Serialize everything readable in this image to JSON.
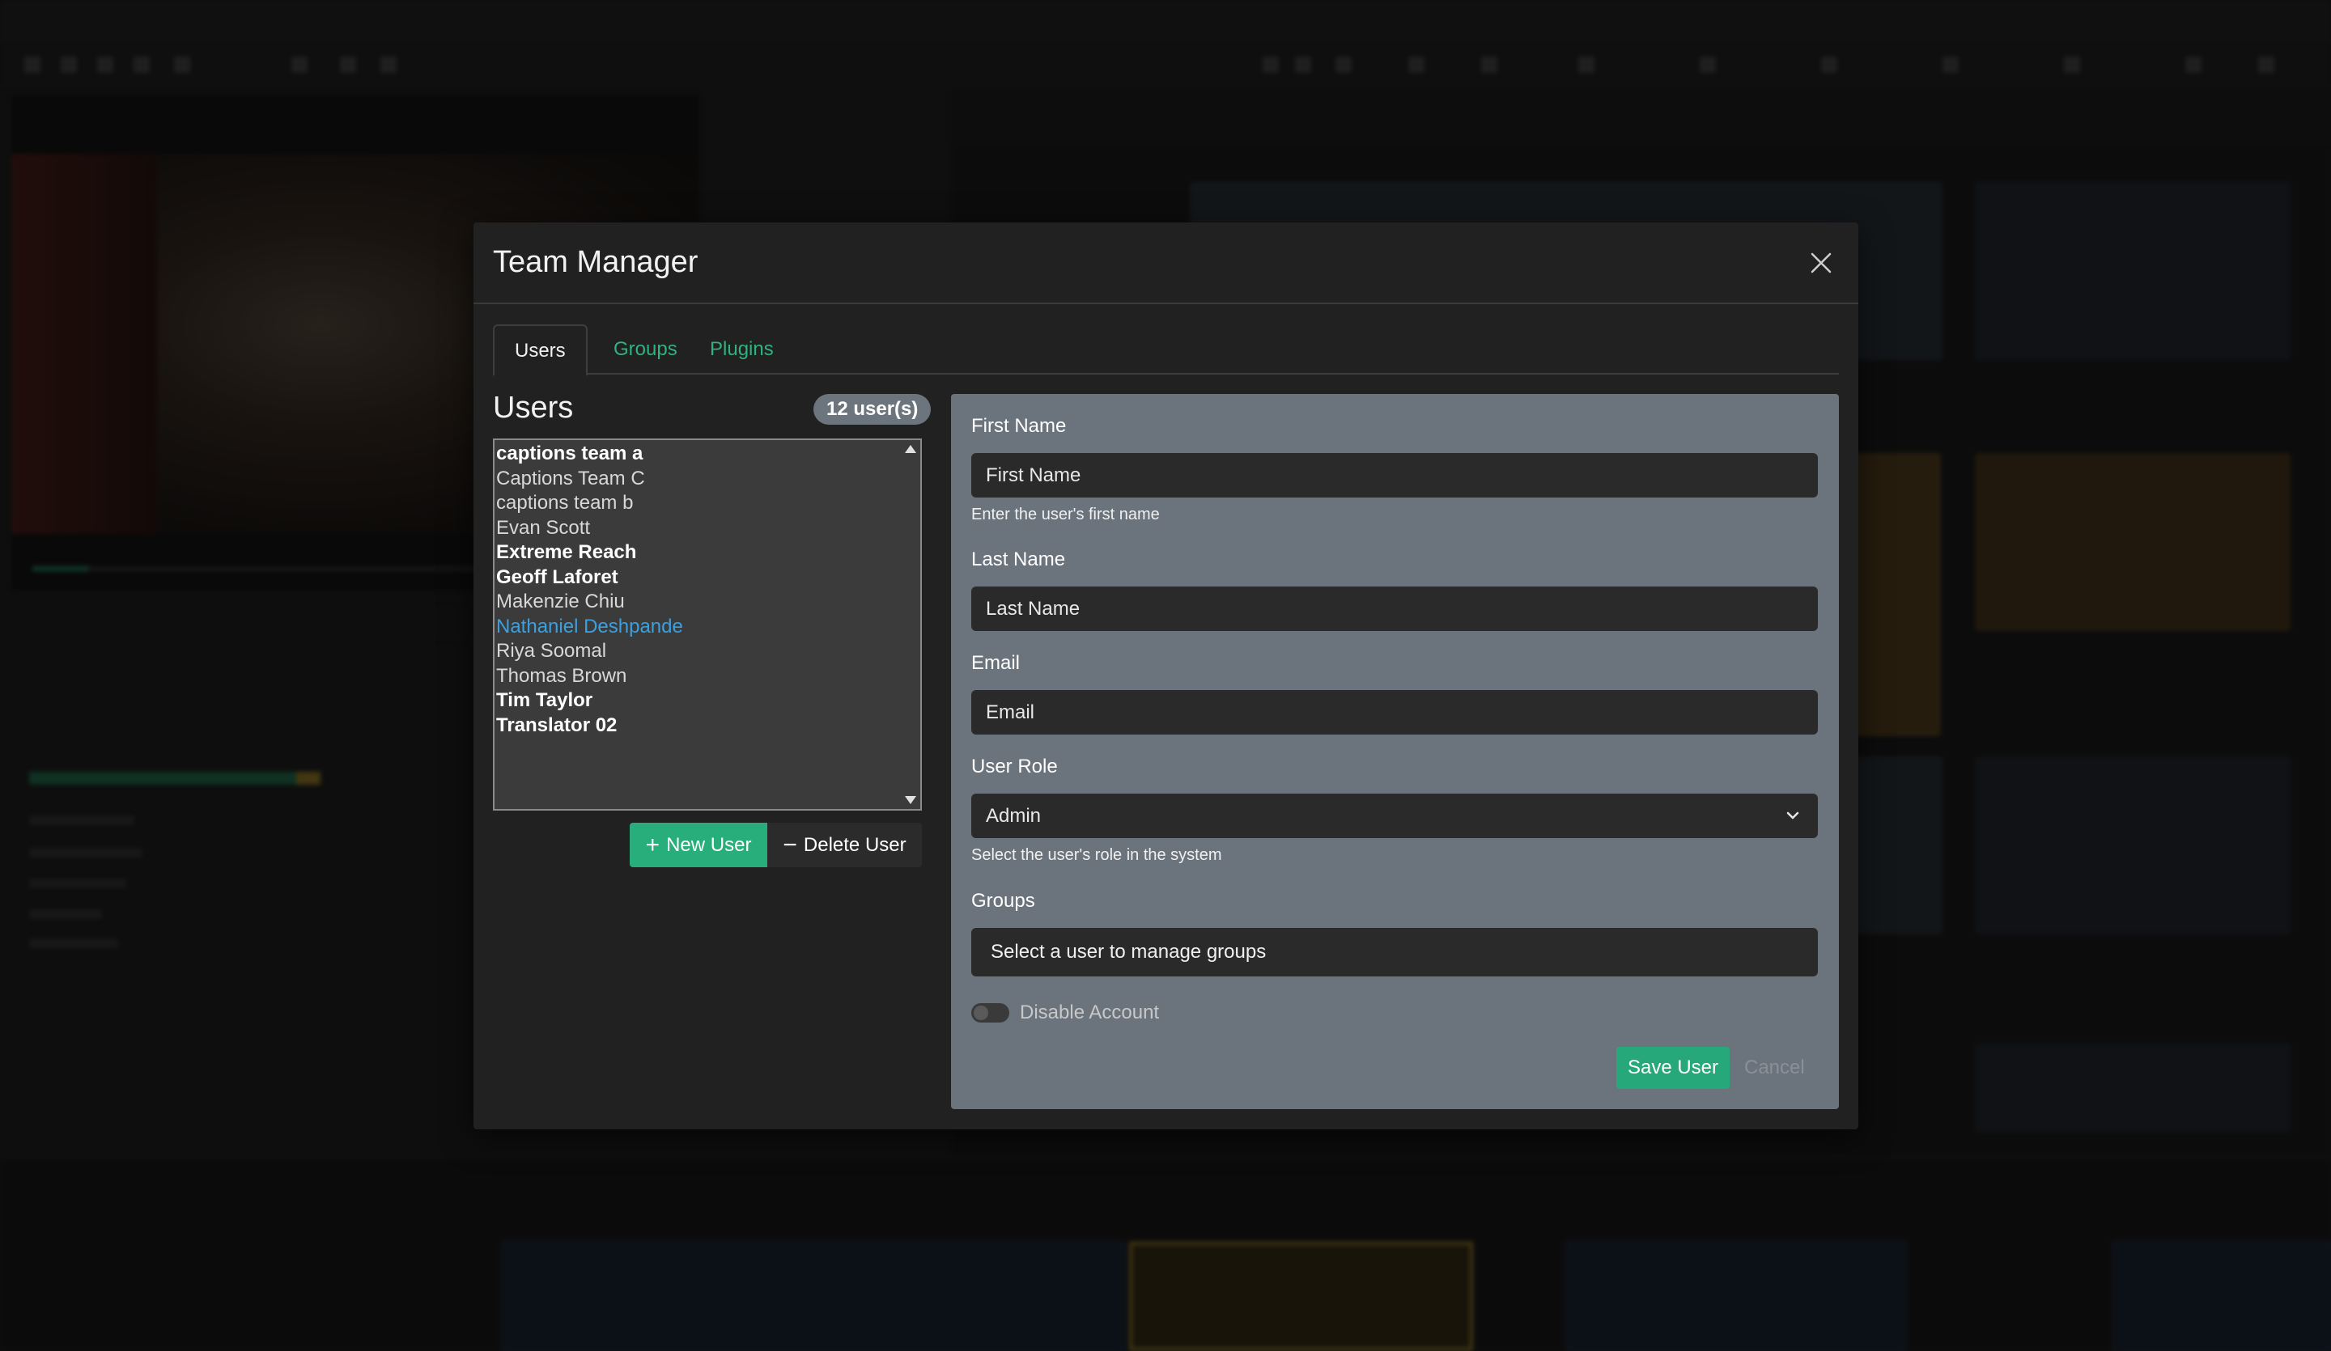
{
  "modal": {
    "title": "Team Manager",
    "tabs": [
      {
        "label": "Users"
      },
      {
        "label": "Groups"
      },
      {
        "label": "Plugins"
      }
    ]
  },
  "users_panel": {
    "heading": "Users",
    "count_badge": "12 user(s)",
    "users": [
      {
        "name": "captions team a",
        "bold": true
      },
      {
        "name": "Captions Team C",
        "bold": false
      },
      {
        "name": "captions team b",
        "bold": false
      },
      {
        "name": "Evan Scott",
        "bold": false
      },
      {
        "name": "Extreme Reach",
        "bold": true
      },
      {
        "name": "Geoff Laforet",
        "bold": true
      },
      {
        "name": "Makenzie Chiu",
        "bold": false
      },
      {
        "name": "Nathaniel Deshpande",
        "bold": false,
        "selected": true
      },
      {
        "name": "Riya Soomal",
        "bold": false
      },
      {
        "name": "Thomas Brown",
        "bold": false
      },
      {
        "name": "Tim Taylor",
        "bold": true
      },
      {
        "name": "Translator 02",
        "bold": true
      }
    ],
    "new_user_label": "New User",
    "delete_user_label": "Delete User"
  },
  "form": {
    "first_name_label": "First Name",
    "first_name_placeholder": "First Name",
    "first_name_hint": "Enter the user's first name",
    "last_name_label": "Last Name",
    "last_name_placeholder": "Last Name",
    "email_label": "Email",
    "email_placeholder": "Email",
    "role_label": "User Role",
    "role_value": "Admin",
    "role_hint": "Select the user's role in the system",
    "groups_label": "Groups",
    "groups_placeholder": "Select a user to manage groups",
    "disable_label": "Disable Account",
    "disable_checked": false,
    "save_label": "Save User",
    "cancel_label": "Cancel"
  },
  "colors": {
    "accent_green": "#27ae7a",
    "selected_blue": "#3aa0e0",
    "panel_gray": "#6b737c"
  }
}
